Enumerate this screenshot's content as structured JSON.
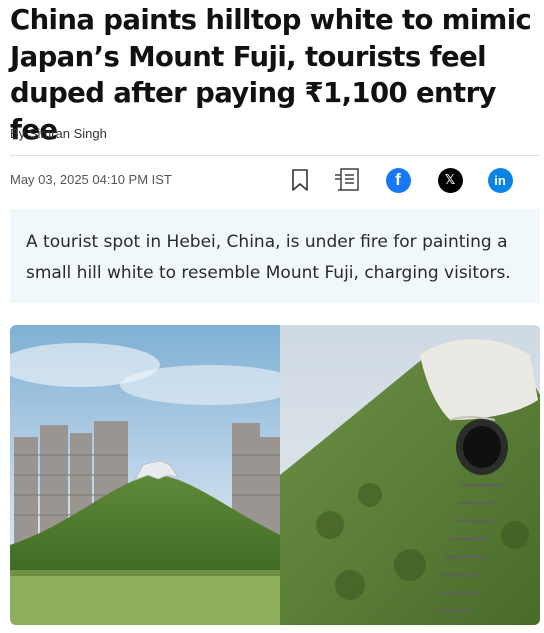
{
  "article": {
    "headline": "China paints hilltop white to mimic Japan’s Mount Fuji, tourists feel duped after paying ₹1,100 entry fee",
    "byline_prefix": "By",
    "author": "Simran Singh",
    "date": "May 03, 2025 04:10 PM IST",
    "synopsis": "A tourist spot in Hebei, China, is under fire for painting a small hill white to resemble Mount Fuji, charging visitors."
  },
  "share": {
    "icons": [
      "bookmark-icon",
      "summary-icon",
      "facebook-icon",
      "x-icon",
      "linkedin-icon"
    ],
    "facebook_glyph": "f",
    "x_glyph": "𝕏",
    "linkedin_glyph": "in",
    "colors": {
      "facebook": "#1877f2",
      "x": "#000000",
      "linkedin": "#0a84e4"
    }
  },
  "colors": {
    "synopsis_bg": "#f1f8fc",
    "divider": "#e2e2e2"
  }
}
